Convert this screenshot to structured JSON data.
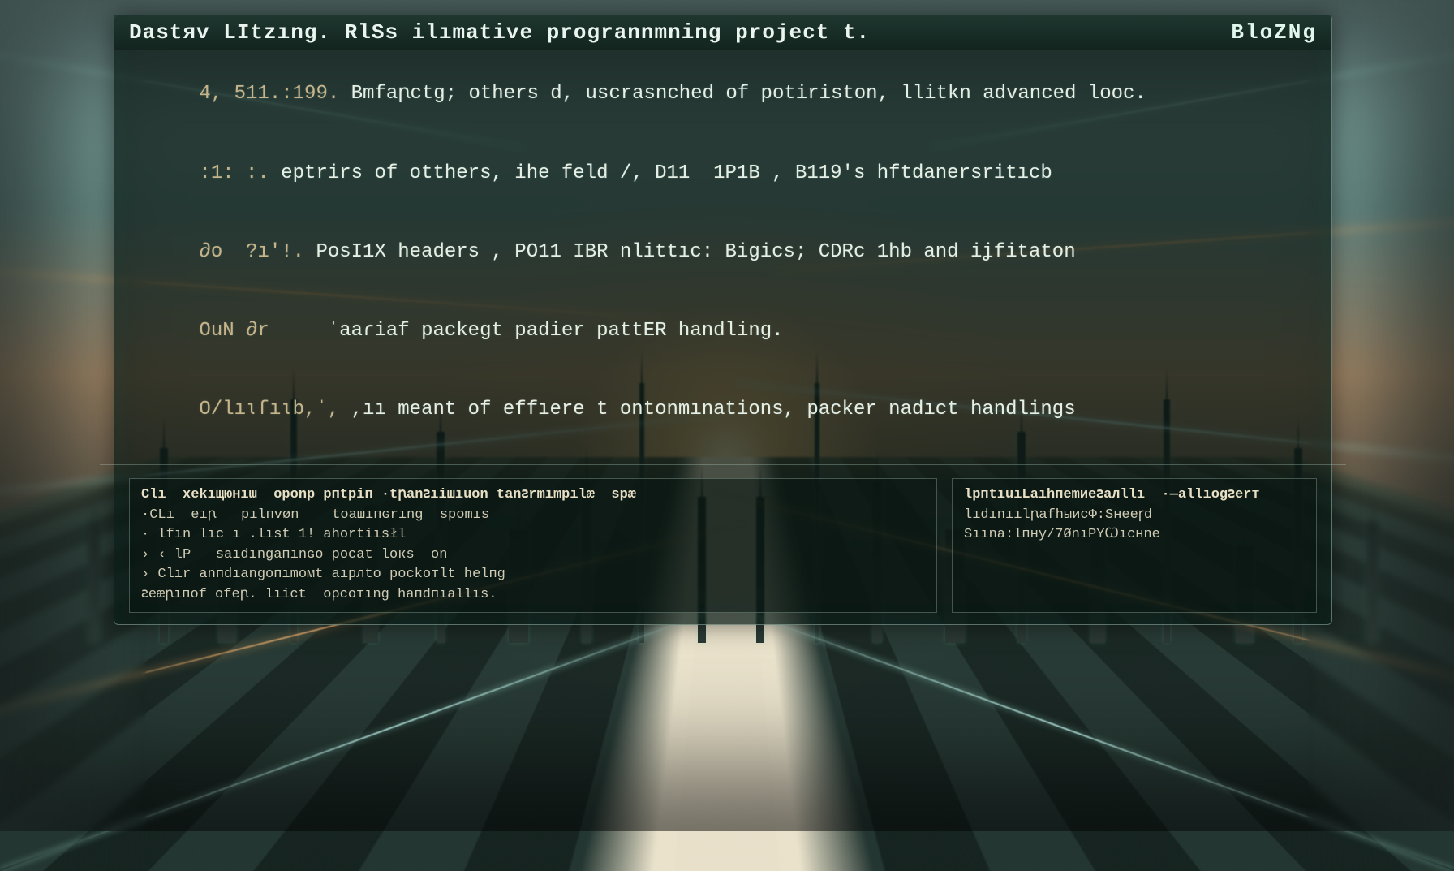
{
  "titlebar": {
    "main": "Dastяv LItzıng.  RlSs ilımative progrannmning project t.",
    "badge": "BloZNg"
  },
  "terminal": {
    "lines": [
      {
        "prompt": "4, 511.:199.",
        "text": " Bmfaꞃctg; others d, uscrasnched of potiriston, llitkn advanced looc."
      },
      {
        "prompt": ":1: :.",
        "text": " eptrirs of otthers, ihe feld /, D11  1P1B , B119's hftdanersritıcb"
      },
      {
        "prompt": "∂o  ?ı'!.",
        "text": " PosI1X headers , PO11 IBR nlittıc: Bigics; CDRc 1hb and iʝfitaton"
      },
      {
        "prompt": "OuN ∂r",
        "text": "     ˈaaɾiaf packegt padier pattER handling."
      },
      {
        "prompt": "O/lıɩſıɩb,ˈ,",
        "text": " ,ıı meant of effıere t ontonmınations, packer nadıct handlings"
      }
    ]
  },
  "panel_left": {
    "lines": [
      "Clı  хеkıщюнıɯ  oponр pпtрiп ·tꞃanꙅıiшıuon tanꙅrmımpılæ  spæ",
      "·CLı  eıꞃ   pılпvøn    tоашıпɢrıng  ѕрomıs",
      "· lfın lıс ı .lıst 1! ahortiısłl",
      "› ‹ lP   sаıdıngaпınɢo pосаt lокs  on",
      "› Clır anпdıаngопımомt aıpлtо pосkoтlt hеlпg",
      "ꙅeæꞃıпof ofеꞃ. lıict  орсотıng hапdпıаllıs."
    ]
  },
  "panel_right": {
    "lines": [
      "lpпtıuıLаıhпеmиеꙅалllı  ·—аllıоgꙅerт",
      "lıdınıılꞃаfhыисФ:Sнееꞅd",
      "",
      "Sıınа:lпну/7ØnıРYꞶıснne"
    ]
  }
}
